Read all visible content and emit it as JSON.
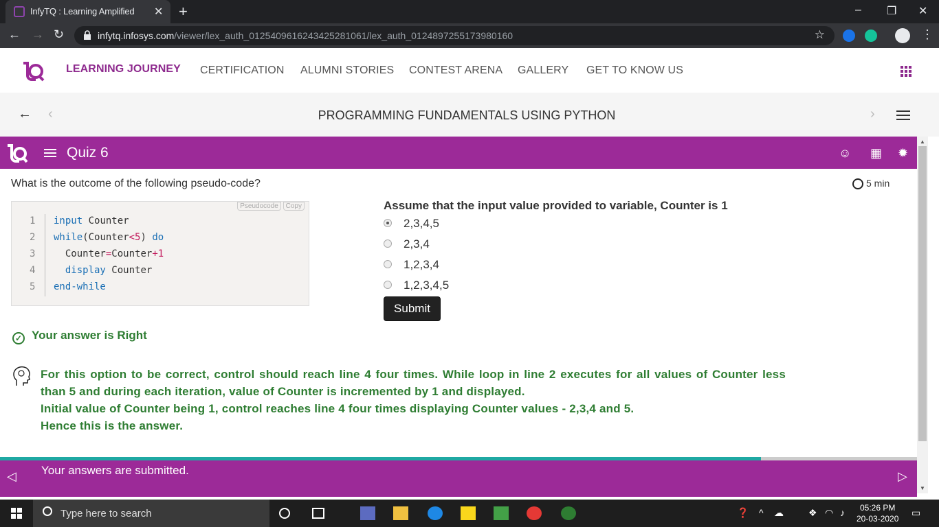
{
  "browser": {
    "tab_title": "InfyTQ : Learning Amplified",
    "url_host": "infytq.infosys.com",
    "url_path": "/viewer/lex_auth_012540961624342528​1061/lex_auth_0124897255173980160"
  },
  "nav": {
    "items": [
      "LEARNING JOURNEY",
      "CERTIFICATION",
      "ALUMNI STORIES",
      "CONTEST ARENA",
      "GALLERY",
      "GET TO KNOW US"
    ],
    "active": "LEARNING JOURNEY"
  },
  "course": {
    "title": "PROGRAMMING FUNDAMENTALS USING PYTHON"
  },
  "quiz": {
    "title": "Quiz 6",
    "question": "What is the outcome of the following pseudo-code?",
    "timer": "5 min",
    "code_tags": {
      "language": "Pseudocode",
      "copy": "Copy"
    },
    "code_lines": [
      {
        "n": "1",
        "text": "input Counter"
      },
      {
        "n": "2",
        "text": "while(Counter<5) do"
      },
      {
        "n": "3",
        "text": "  Counter=Counter+1"
      },
      {
        "n": "4",
        "text": "  display Counter"
      },
      {
        "n": "5",
        "text": "end-while"
      }
    ],
    "assumption": "Assume that the input value provided to variable, Counter is 1",
    "options": [
      "2,3,4,5",
      "2,3,4",
      "1,2,3,4",
      "1,2,3,4,5"
    ],
    "selected_option": 0,
    "submit_label": "Submit",
    "result": "Your answer is Right",
    "explanation": [
      "For this option to be correct, control should reach line 4 four times. While loop in line 2 executes for all values of Counter less than 5 and during each iteration, value of Counter is incremented by 1 and displayed.",
      "Initial value of Counter being 1, control reaches line 4 four times displaying Counter values - 2,3,4 and 5.",
      "Hence this is the answer."
    ],
    "progress_fraction": 0.83,
    "submitted_message": "Your answers are submitted."
  },
  "taskbar": {
    "search_placeholder": "Type here to search",
    "time": "05:26 PM",
    "date": "20-03-2020"
  },
  "colors": {
    "brand_purple": "#9c2a98",
    "success_green": "#2e7d32",
    "progress_teal": "#1fa9a3"
  }
}
